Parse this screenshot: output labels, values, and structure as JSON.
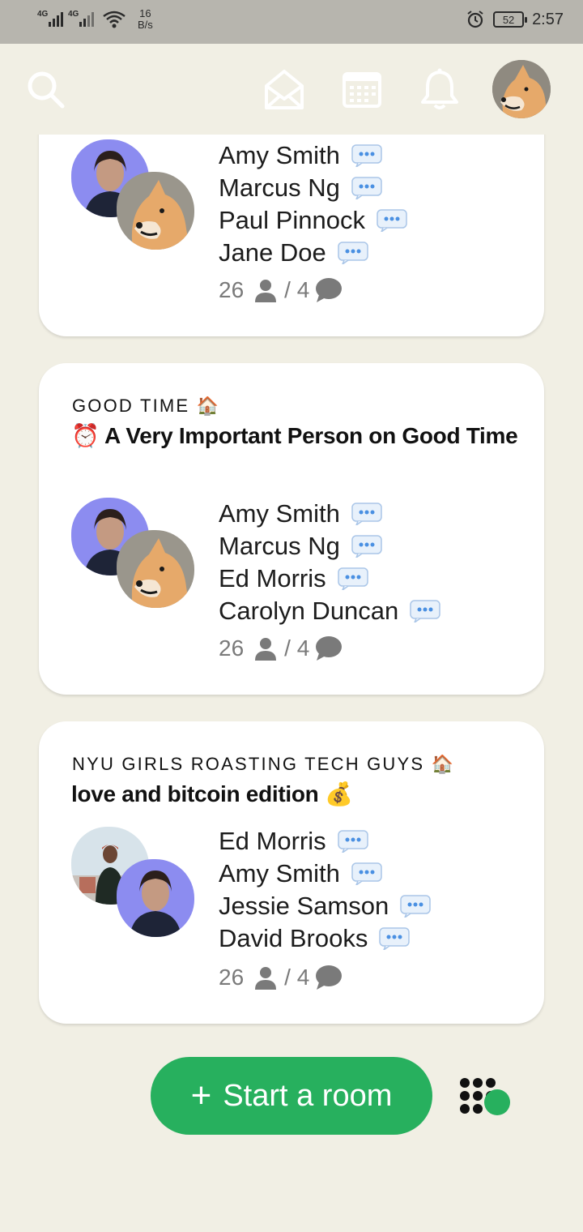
{
  "status_bar": {
    "signal1": "4G",
    "signal2": "4G",
    "speed_value": "16",
    "speed_unit": "B/s",
    "battery": "52",
    "time": "2:57"
  },
  "nav": {
    "icons": [
      "search-icon",
      "envelope-icon",
      "calendar-icon",
      "bell-icon",
      "profile-avatar"
    ]
  },
  "rooms": [
    {
      "club": "",
      "title": "",
      "speakers": [
        "Amy Smith",
        "Marcus Ng",
        "Paul Pinnock",
        "Jane Doe"
      ],
      "listeners": "26",
      "speakers_count": "/ 4"
    },
    {
      "club": "GOOD TIME 🏠",
      "title": "⏰ A Very Important Person on Good Time",
      "speakers": [
        "Amy Smith",
        "Marcus Ng",
        "Ed Morris",
        "Carolyn Duncan"
      ],
      "listeners": "26",
      "speakers_count": "/ 4"
    },
    {
      "club": "NYU GIRLS ROASTING TECH GUYS 🏠",
      "title": "love and bitcoin edition 💰",
      "speakers": [
        "Ed Morris",
        "Amy Smith",
        "Jessie Samson",
        "David Brooks"
      ],
      "listeners": "26",
      "speakers_count": "/ 4"
    }
  ],
  "start_room": {
    "plus": "+",
    "label": "Start a room"
  },
  "colors": {
    "background": "#f1efe4",
    "accent": "#27b05e",
    "status_bar": "#b7b5ae"
  }
}
